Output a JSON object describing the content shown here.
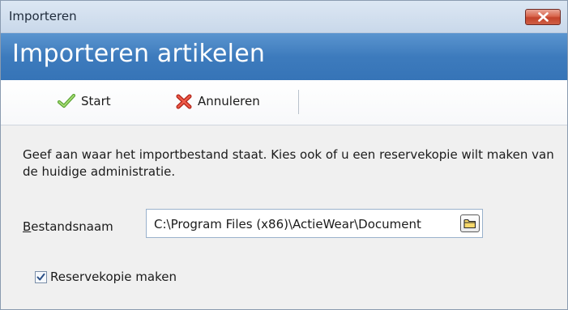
{
  "window": {
    "title": "Importeren"
  },
  "header": {
    "heading": "Importeren artikelen"
  },
  "toolbar": {
    "start_label": "Start",
    "cancel_label": "Annuleren"
  },
  "content": {
    "description": "Geef aan waar het importbestand staat. Kies ook of u een reservekopie wilt maken van de huidige administratie.",
    "file_label_accesskey": "B",
    "file_label_rest": "estandsnaam",
    "file_path": "C:\\Program Files (x86)\\ActieWear\\Document",
    "backup_checkbox": {
      "label": "Reservekopie maken",
      "checked": true
    }
  },
  "icons": {
    "close": "close-x-icon",
    "start": "checkmark-icon",
    "cancel": "red-x-icon",
    "browse": "folder-icon",
    "checkbox_mark": "checkmark-icon"
  },
  "colors": {
    "header_blue": "#3d7bbd",
    "close_red": "#c3432b",
    "start_green": "#7cc24a",
    "cancel_red": "#d23b2d"
  }
}
